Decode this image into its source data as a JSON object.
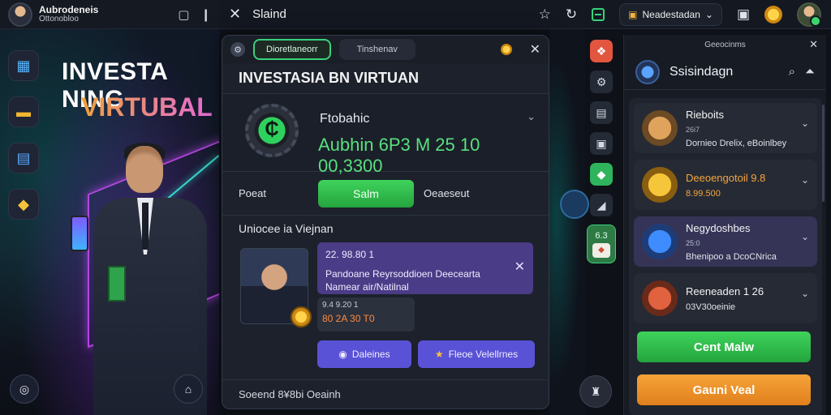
{
  "left": {
    "user_name": "Aubrodeneis",
    "user_sub": "Ottonobloo",
    "hero_title": "INVESTA NING",
    "hero_sub": "VIRTUBAL"
  },
  "topbar": {
    "title": "Slaind",
    "dropdown_label": "Neadestadan"
  },
  "modal": {
    "tab_active": "Dioretlaneorr",
    "tab_inactive": "Tinshenav",
    "title": "INVESTASIA BN VIRTUAN",
    "balance_label": "Ftobahic",
    "balance_value": "Aubhin 6P3 M 25 10 00,3300",
    "action_label": "Poeat",
    "action_button": "Salm",
    "action_link": "Oeaeseut",
    "section_label": "Uniocee ia Viejnan",
    "card_line1": "22. 98.80 1",
    "card_line2": "Pandoane Reyrsoddioen  Deecearta",
    "card_line3": "Namear air/Natilnal",
    "small_line1": "9.4 9.20 1",
    "small_line2": "80 2A 30 T0",
    "btn1": "Daleines",
    "btn2": "Fleoe Velellrnes",
    "footer": "Soeend 8¥8bi Oeainh"
  },
  "icon_column": {
    "badge_label": "6.3"
  },
  "right_panel": {
    "top_label": "Geeocinms",
    "title": "Ssisindagn",
    "items": [
      {
        "name": "Rieboits",
        "value": "26i7",
        "desc": "Dornieo Drelix, eBoinlbey"
      },
      {
        "name": "Deeoengotoil 9.8",
        "value": "8.99.500",
        "desc": ""
      },
      {
        "name": "Negydoshbes",
        "value": "25:0",
        "desc": "Bhenipoo a DcoCNrica"
      },
      {
        "name": "Reeneaden 1 26",
        "value": "03V30oeinie",
        "desc": ""
      }
    ],
    "btn_green": "Cent Malw",
    "btn_orange": "Gauni Veal"
  }
}
